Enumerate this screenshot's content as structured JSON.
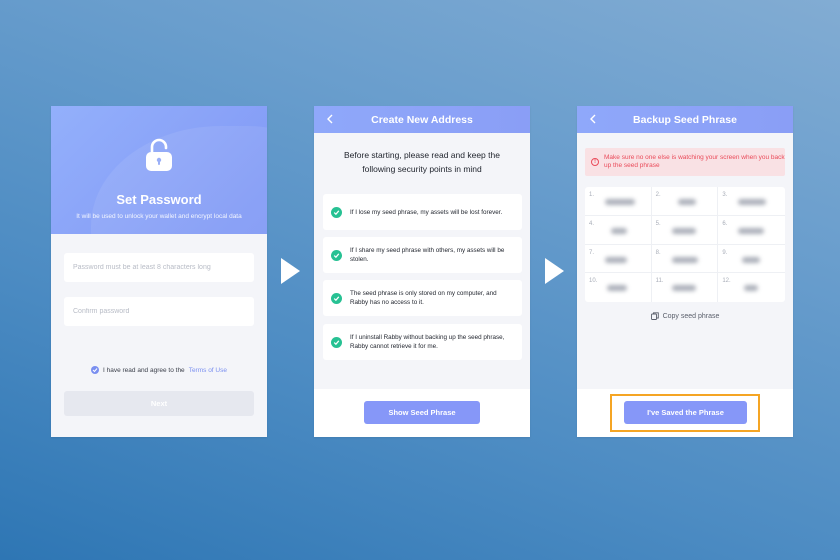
{
  "colors": {
    "accent": "#8697f8",
    "success": "#27c193",
    "danger": "#ea4b5a",
    "highlight": "#f5a524"
  },
  "set_password": {
    "icon": "lock-icon",
    "title": "Set Password",
    "subtitle": "It will be used to unlock your wallet and encrypt local data",
    "password_placeholder": "Password must be at least 8 characters long",
    "confirm_placeholder": "Confirm password",
    "agree_text": "I have read and agree to the",
    "terms_link": "Terms of Use",
    "agree_checked": true,
    "next_label": "Next"
  },
  "create_address": {
    "title": "Create New Address",
    "intro_line1": "Before starting, please read and keep the",
    "intro_line2": "following security points in mind",
    "points": [
      "If I lose my seed phrase, my assets will be lost forever.",
      "If I share my seed phrase with others, my assets will be stolen.",
      "The seed phrase is only stored on my computer, and Rabby has no access to it.",
      "If I uninstall Rabby without backing up the seed phrase, Rabby cannot retrieve it for me."
    ],
    "button_label": "Show Seed Phrase"
  },
  "backup_seed": {
    "title": "Backup Seed Phrase",
    "warning": "Make sure no one else is watching your screen when you back up the seed phrase",
    "word_numbers": [
      "1.",
      "2.",
      "3.",
      "4.",
      "5.",
      "6.",
      "7.",
      "8.",
      "9.",
      "10.",
      "11.",
      "12."
    ],
    "copy_label": "Copy seed phrase",
    "button_label": "I've Saved the Phrase"
  }
}
